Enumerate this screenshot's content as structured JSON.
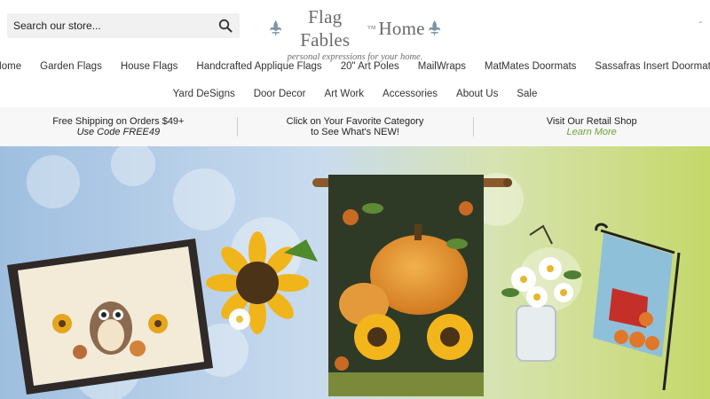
{
  "search": {
    "placeholder": "Search our store...",
    "icon": "search-icon"
  },
  "logo": {
    "name_part1": "Flag Fables",
    "name_part2": "Home",
    "tm": "TM",
    "tagline": "personal expressions for your home."
  },
  "header": {
    "right_text": "-"
  },
  "nav": {
    "row1": [
      "Home",
      "Garden Flags",
      "House Flags",
      "Handcrafted Applique Flags",
      "20\" Art Poles",
      "MailWraps",
      "MatMates Doormats",
      "Sassafras Insert Doormats"
    ],
    "row2": [
      "Yard DeSigns",
      "Door Decor",
      "Art Work",
      "Accessories",
      "About Us",
      "Sale"
    ]
  },
  "promo": {
    "shipping_title": "Free Shipping on Orders $49+",
    "shipping_code": "Use Code FREE49",
    "category_line1": "Click on Your Favorite Category",
    "category_line2": "to See What's NEW!",
    "retail_title": "Visit Our Retail Shop",
    "retail_link": "Learn More"
  },
  "colors": {
    "accent_green": "#6fa33a",
    "promo_bg": "#f7f7f7",
    "logo_gray": "#6b6b6b",
    "fleur_blue": "#7d94a8"
  }
}
